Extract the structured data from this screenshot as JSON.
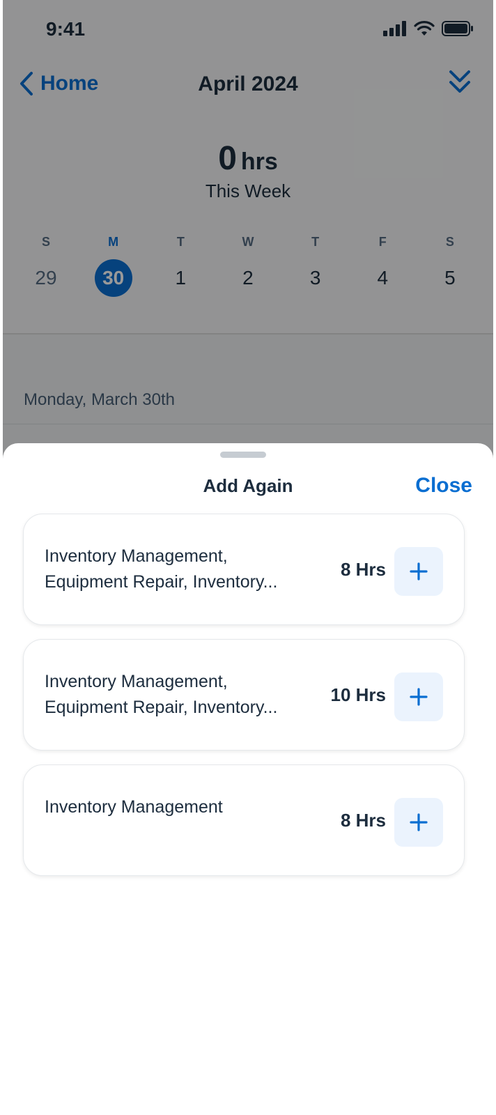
{
  "status_bar": {
    "time": "9:41",
    "icons": [
      "signal-icon",
      "wifi-icon",
      "battery-icon"
    ]
  },
  "nav": {
    "back_label": "Home",
    "title": "April 2024",
    "expand_icon": "double-chevron-down-icon"
  },
  "summary": {
    "hours_value": "0",
    "hours_unit": "hrs",
    "label": "This Week"
  },
  "week": {
    "days": [
      {
        "letter": "S",
        "date": "29",
        "state": "muted"
      },
      {
        "letter": "M",
        "date": "30",
        "state": "active"
      },
      {
        "letter": "T",
        "date": "1",
        "state": "normal"
      },
      {
        "letter": "W",
        "date": "2",
        "state": "normal"
      },
      {
        "letter": "T",
        "date": "3",
        "state": "normal"
      },
      {
        "letter": "F",
        "date": "4",
        "state": "normal"
      },
      {
        "letter": "S",
        "date": "5",
        "state": "normal"
      }
    ]
  },
  "day_heading": "Monday, March 30th",
  "sheet": {
    "title": "Add Again",
    "close_label": "Close",
    "items": [
      {
        "line1": "Inventory Management,",
        "line2": "Equipment Repair, Inventory...",
        "hours": "8 Hrs"
      },
      {
        "line1": "Inventory Management,",
        "line2": "Equipment Repair, Inventory...",
        "hours": "10 Hrs"
      },
      {
        "line1": "Inventory Management",
        "line2": "",
        "hours": "8 Hrs"
      }
    ]
  },
  "colors": {
    "accent": "#0a6ed1",
    "text": "#1d2d3e",
    "add_button_bg": "#ebf3fd"
  }
}
